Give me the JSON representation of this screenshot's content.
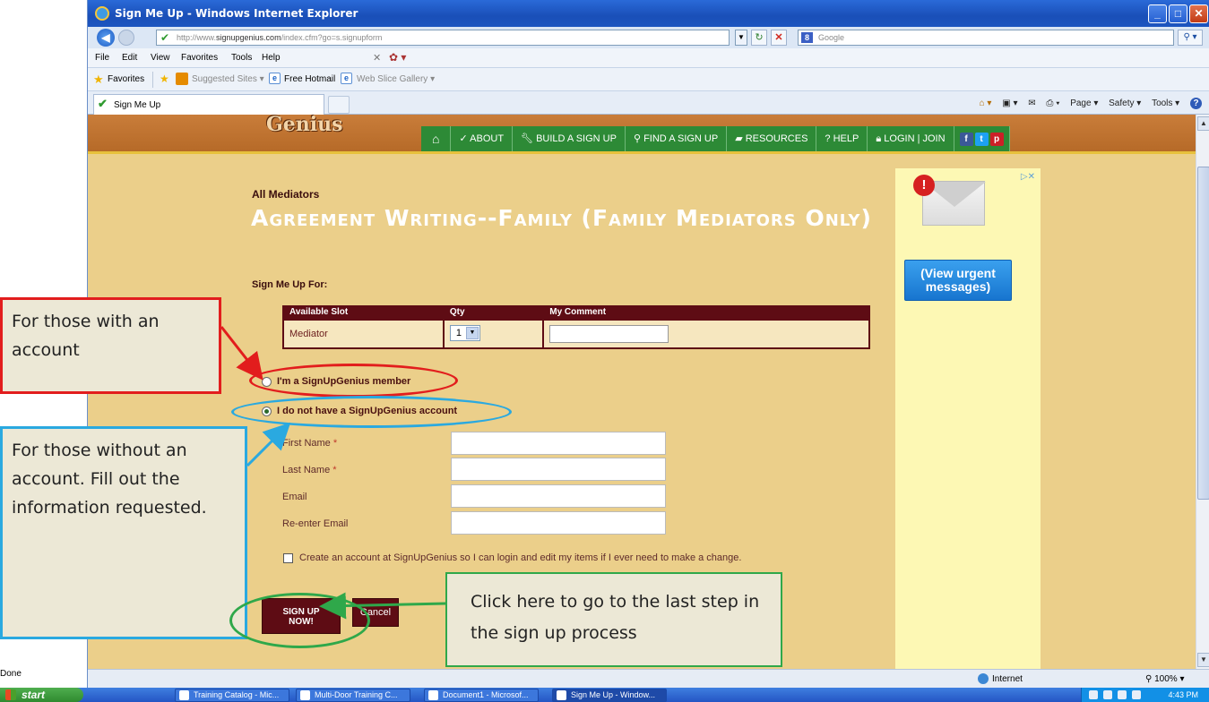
{
  "window": {
    "title": "Sign Me Up - Windows Internet Explorer",
    "controls": [
      "_",
      "□",
      "✕"
    ]
  },
  "address": {
    "url_prefix": "http://www.",
    "url_domain": "signupgenius.com",
    "url_rest": "/index.cfm?go=s.signupform",
    "search_placeholder": "Google"
  },
  "menu": {
    "items": [
      "File",
      "Edit",
      "View",
      "Favorites",
      "Tools",
      "Help"
    ]
  },
  "favorites_bar": {
    "label": "Favorites",
    "suggested": "Suggested Sites ▾",
    "hotmail": "Free Hotmail",
    "web_slice": "Web Slice Gallery ▾"
  },
  "tab": {
    "label": "Sign Me Up"
  },
  "command_bar": {
    "page": "Page ▾",
    "safety": "Safety ▾",
    "tools": "Tools ▾"
  },
  "site": {
    "logo": "Genius",
    "nav": [
      "ABOUT",
      "BUILD A SIGN UP",
      "FIND A SIGN UP",
      "RESOURCES",
      "HELP",
      "LOGIN | JOIN"
    ],
    "nav_home_glyph": "⌂",
    "social": [
      "f",
      "t",
      "p"
    ]
  },
  "form": {
    "group": "All Mediators",
    "title": "Agreement Writing--Family (Family Mediators Only)",
    "signup_for": "Sign Me Up For:",
    "table": {
      "headers": [
        "Available Slot",
        "Qty",
        "My Comment"
      ],
      "rows": [
        {
          "slot": "Mediator",
          "qty": "1"
        }
      ]
    },
    "member_option": "I'm a SignUpGenius member",
    "non_member_option": "I do not have a SignUpGenius account",
    "fields": {
      "first_name": "First Name",
      "last_name": "Last Name",
      "email": "Email",
      "reenter_email": "Re-enter Email",
      "required_mark": "*"
    },
    "create_account": "Create an account at SignUpGenius so I can login and edit my items if I ever need to make a change.",
    "signup_button_line1": "SIGN UP",
    "signup_button_line2": "NOW!",
    "cancel_button": "Cancel"
  },
  "ad": {
    "button_line1": "(View urgent",
    "button_line2": "messages)"
  },
  "status": {
    "left": "Done",
    "zone": "Internet",
    "zoom": "100%"
  },
  "taskbar": {
    "start": "start",
    "tasks": [
      "Training Catalog - Mic...",
      "Multi-Door Training C...",
      "Document1 - Microsof...",
      "Sign Me Up - Window..."
    ],
    "clock": "4:43 PM"
  },
  "annotations": {
    "red": "For those with an account",
    "blue": "For those without an account. Fill out the information requested.",
    "green": "Click here to go to the last step in the sign up process"
  },
  "colors": {
    "annotation_red": "#e21d1d",
    "annotation_blue": "#2aa9e0",
    "annotation_green": "#2fa84a",
    "site_maroon": "#5e0c14",
    "site_nav_green": "#2d8a36",
    "page_bg": "#ebcf8a"
  }
}
